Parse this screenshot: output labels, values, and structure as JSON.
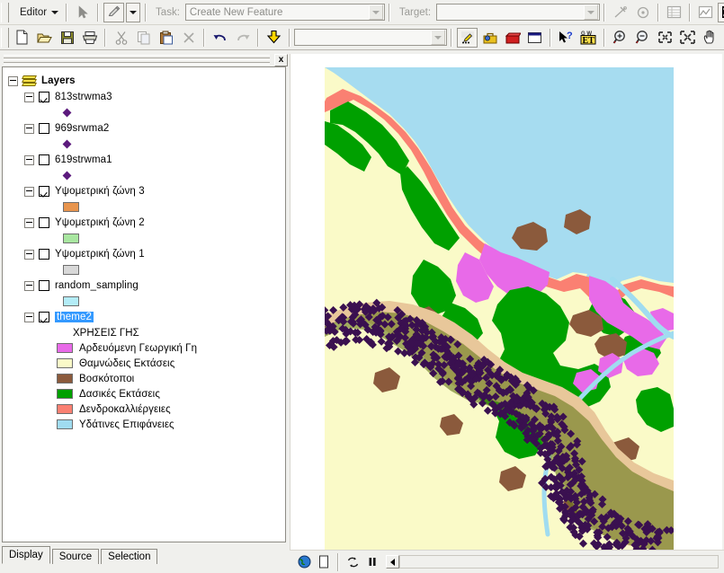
{
  "toolbars": {
    "editor": {
      "menu_label": "Editor",
      "sketch_tool_icon": "pencil-icon",
      "arrow_icon": "pointer-arrow-icon",
      "task_label": "Task:",
      "task_value": "Create New Feature",
      "target_label": "Target:",
      "target_value": "",
      "tool_icons": [
        "split-tool-icon",
        "rotate-tool-icon",
        "attributes-table-icon",
        "sketch-properties-icon",
        "edit-sketch-grid-icon",
        "dimension-tool-icon",
        "snapping-tool-icon"
      ]
    },
    "standard": {
      "icons": [
        "new-document-icon",
        "open-folder-icon",
        "save-icon",
        "print-icon",
        "cut-icon",
        "copy-icon",
        "paste-icon",
        "delete-icon",
        "undo-icon",
        "redo-icon",
        "add-data-icon"
      ],
      "scale_value": "",
      "right_icons": [
        "editor-toolbar-icon",
        "toolbox-icon",
        "model-builder-icon",
        "command-window-icon",
        "whats-this-help-icon",
        "et-geowizards-icon"
      ],
      "nav_icons": [
        "zoom-in-icon",
        "zoom-out-icon",
        "fixed-zoom-in-icon",
        "fixed-zoom-out-icon",
        "pan-hand-icon",
        "full-extent-globe-icon",
        "go-back-extent-icon",
        "go-forward-extent-icon"
      ]
    }
  },
  "toc": {
    "close_label": "x",
    "root": {
      "label": "Layers",
      "icon": "layer-stack-icon"
    },
    "layers": [
      {
        "label": "813strwma3",
        "checked": true,
        "symbol": "point",
        "color": "#5c1a7d",
        "selected": false
      },
      {
        "label": "969srwma2",
        "checked": false,
        "symbol": "point",
        "color": "#5c1a7d",
        "selected": false
      },
      {
        "label": "619strwma1",
        "checked": false,
        "symbol": "point",
        "color": "#5c1a7d",
        "selected": false
      },
      {
        "label": "Υψομετρική ζώνη 3",
        "checked": true,
        "symbol": "polygon",
        "color": "#e8954e",
        "selected": false
      },
      {
        "label": "Υψομετρική ζώνη 2",
        "checked": false,
        "symbol": "polygon",
        "color": "#a8e6a0",
        "selected": false
      },
      {
        "label": "Υψομετρική ζώνη 1",
        "checked": false,
        "symbol": "polygon",
        "color": "#d8d8d8",
        "selected": false
      },
      {
        "label": "random_sampling",
        "checked": false,
        "symbol": "polygon",
        "color": "#b3ecf7",
        "selected": false
      },
      {
        "label": "theme2",
        "checked": true,
        "symbol": "classified",
        "selected": true
      }
    ],
    "theme2_legend": {
      "heading": "ΧΡΗΣΕΙΣ ΓΗΣ",
      "classes": [
        {
          "label": "Αρδευόμενη Γεωργική Γη",
          "color": "#e86ae8"
        },
        {
          "label": "Θαμνώδεις Εκτάσεις",
          "color": "#fafac8"
        },
        {
          "label": "Βοσκότοποι",
          "color": "#8b5a3c"
        },
        {
          "label": "Δασικές Εκτάσεις",
          "color": "#00a000"
        },
        {
          "label": "Δενδροκαλλιέργειες",
          "color": "#fa8072"
        },
        {
          "label": "Υδάτινες Επιφάνειες",
          "color": "#a0dcf0"
        }
      ]
    },
    "tabs": [
      {
        "label": "Display",
        "active": true
      },
      {
        "label": "Source",
        "active": false
      },
      {
        "label": "Selection",
        "active": false
      }
    ]
  },
  "map": {
    "colors": {
      "sea": "#a6dcf0",
      "water": "#a0dcf0",
      "shrub": "#fafac8",
      "forest": "#00a000",
      "pasture": "#8b5a3c",
      "orchard": "#fa8072",
      "irrigated": "#e86ae8",
      "sample_zone": "#9a9a52",
      "sample_zone_edge": "#e8c79a",
      "sample_point": "#3a1050",
      "background": "#ffffff"
    },
    "status_icons": [
      "drawing-globe-icon",
      "page-layout-icon",
      "refresh-icon",
      "pause-drawing-icon",
      "scroll-left-icon"
    ]
  }
}
